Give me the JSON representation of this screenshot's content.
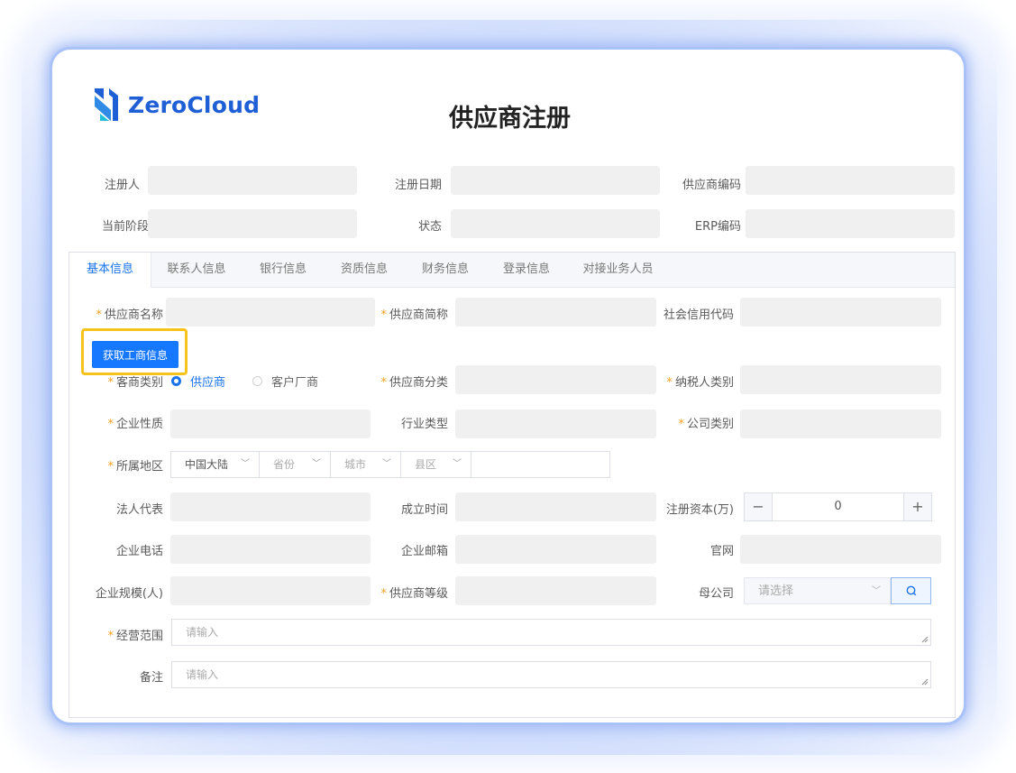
{
  "brand": {
    "name": "ZeroCloud",
    "color": "#1f5fd6"
  },
  "page_title": "供应商注册",
  "header_fields": [
    {
      "label": "注册人"
    },
    {
      "label": "注册日期"
    },
    {
      "label": "供应商编码"
    },
    {
      "label": "当前阶段"
    },
    {
      "label": "状态"
    },
    {
      "label": "ERP编码"
    }
  ],
  "tabs": [
    {
      "label": "基本信息",
      "active": true
    },
    {
      "label": "联系人信息"
    },
    {
      "label": "银行信息"
    },
    {
      "label": "资质信息"
    },
    {
      "label": "财务信息"
    },
    {
      "label": "登录信息"
    },
    {
      "label": "对接业务人员"
    }
  ],
  "form": {
    "supplier_name": "供应商名称",
    "supplier_short": "供应商简称",
    "credit_code": "社会信用代码",
    "fetch_button": "获取工商信息",
    "merchant_type": "客商类别",
    "merchant_opt1": "供应商",
    "merchant_opt2": "客户厂商",
    "supplier_category": "供应商分类",
    "taxpayer_type": "纳税人类别",
    "enterprise_nature": "企业性质",
    "industry_type": "行业类型",
    "company_type": "公司类别",
    "region_label": "所属地区",
    "region_country": "中国大陆",
    "region_province": "省份",
    "region_city": "城市",
    "region_county": "县区",
    "legal_rep": "法人代表",
    "established": "成立时间",
    "reg_capital": "注册资本(万)",
    "stepper_minus": "−",
    "stepper_value": "0",
    "stepper_plus": "+",
    "company_phone": "企业电话",
    "company_email": "企业邮箱",
    "website": "官网",
    "company_size": "企业规模(人)",
    "supplier_level": "供应商等级",
    "parent_company": "母公司",
    "parent_placeholder": "请选择",
    "business_scope": "经营范围",
    "scope_placeholder": "请输入",
    "remarks": "备注",
    "remarks_placeholder": "请输入"
  },
  "colors": {
    "accent": "#1677ff",
    "highlight": "#f7c21a",
    "required": "#f0a020"
  }
}
